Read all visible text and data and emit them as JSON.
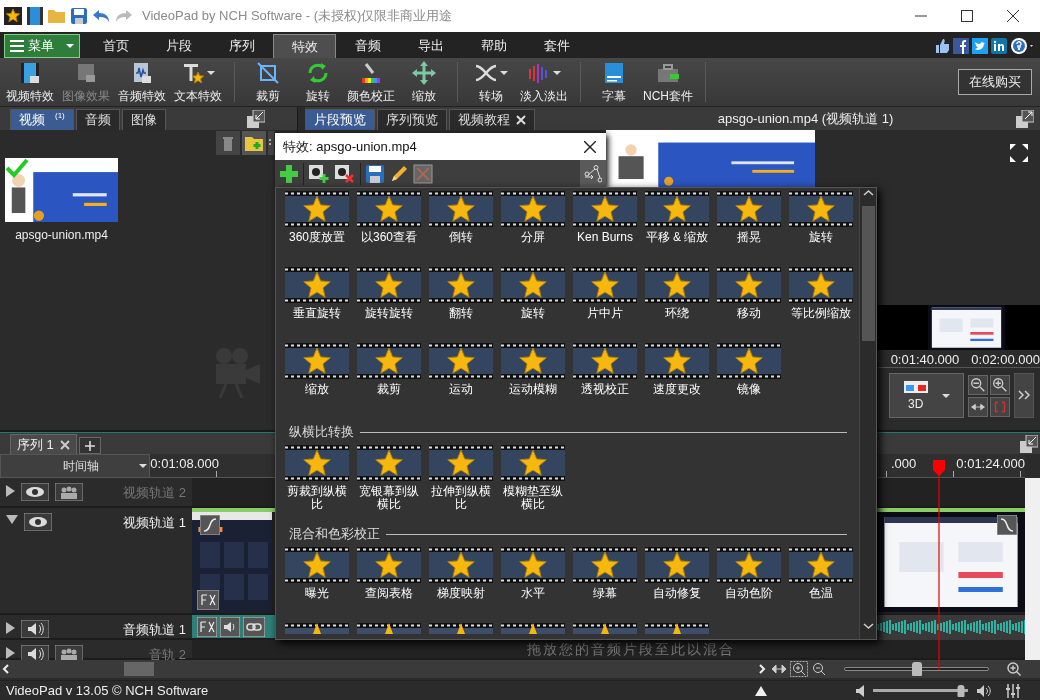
{
  "window": {
    "title": "VideoPad by NCH Software - (未授权)仅限非商业用途"
  },
  "menu_button": {
    "label": "菜单"
  },
  "tabs": [
    {
      "label": "首页",
      "selected": false
    },
    {
      "label": "片段",
      "selected": false
    },
    {
      "label": "序列",
      "selected": false
    },
    {
      "label": "特效",
      "selected": true
    },
    {
      "label": "音频",
      "selected": false
    },
    {
      "label": "导出",
      "selected": false
    },
    {
      "label": "帮助",
      "selected": false
    },
    {
      "label": "套件",
      "selected": false
    }
  ],
  "ribbon_groups": [
    [
      {
        "label": "视频特效",
        "disabled": false,
        "dropdown": false
      },
      {
        "label": "图像效果",
        "disabled": true,
        "dropdown": false
      },
      {
        "label": "音频特效",
        "disabled": false,
        "dropdown": false
      },
      {
        "label": "文本特效",
        "disabled": false,
        "dropdown": true
      }
    ],
    [
      {
        "label": "裁剪",
        "disabled": false,
        "dropdown": false
      },
      {
        "label": "旋转",
        "disabled": false,
        "dropdown": false
      },
      {
        "label": "颜色校正",
        "disabled": false,
        "dropdown": false
      },
      {
        "label": "缩放",
        "disabled": false,
        "dropdown": false
      }
    ],
    [
      {
        "label": "转场",
        "disabled": false,
        "dropdown": true
      },
      {
        "label": "淡入淡出",
        "disabled": false,
        "dropdown": true
      }
    ],
    [
      {
        "label": "字幕",
        "disabled": false,
        "dropdown": false
      },
      {
        "label": "NCH套件",
        "disabled": false,
        "dropdown": false
      }
    ]
  ],
  "buy_button": {
    "label": "在线购买"
  },
  "bin": {
    "tabs": [
      {
        "label": "视频",
        "count": "(1)",
        "selected": true
      },
      {
        "label": "音频",
        "selected": false
      },
      {
        "label": "图像",
        "selected": false
      }
    ],
    "files": [
      {
        "name": "apsgo-union.mp4",
        "checked": true
      }
    ]
  },
  "preview": {
    "tabs": [
      {
        "label": "片段预览",
        "selected": true,
        "closable": false
      },
      {
        "label": "序列预览",
        "selected": false,
        "closable": false
      },
      {
        "label": "视频教程",
        "selected": false,
        "closable": true
      }
    ],
    "title": "apsgo-union.mp4  (视频轨道 1)",
    "times": [
      "0:01:40.000",
      "0:02:00.000"
    ],
    "mode_button": {
      "label": "3D"
    }
  },
  "effects_dialog": {
    "title": "特效: apsgo-union.mp4",
    "sections": [
      {
        "items": [
          {
            "label": "360度放置",
            "kind": "effect"
          },
          {
            "label": "以360查看",
            "kind": "effect"
          },
          {
            "label": "倒转",
            "kind": "effect"
          },
          {
            "label": "分屏",
            "kind": "effect"
          },
          {
            "label": "Ken Burns",
            "kind": "effect"
          },
          {
            "label": "平移 & 缩放",
            "kind": "effect"
          },
          {
            "label": "摇晃",
            "kind": "effect"
          },
          {
            "label": "旋转",
            "kind": "effect"
          },
          {
            "label": "垂直旋转",
            "kind": "effect"
          },
          {
            "label": "旋转旋转",
            "kind": "effect"
          },
          {
            "label": "翻转",
            "kind": "effect"
          },
          {
            "label": "旋转",
            "kind": "effect"
          },
          {
            "label": "片中片",
            "kind": "effect"
          },
          {
            "label": "环绕",
            "kind": "effect"
          },
          {
            "label": "移动",
            "kind": "effect"
          },
          {
            "label": "等比例缩放",
            "kind": "effect"
          },
          {
            "label": "缩放",
            "kind": "effect"
          },
          {
            "label": "裁剪",
            "kind": "effect"
          },
          {
            "label": "运动",
            "kind": "effect"
          },
          {
            "label": "运动模糊",
            "kind": "effect"
          },
          {
            "label": "透视校正",
            "kind": "effect"
          },
          {
            "label": "速度更改",
            "kind": "effect"
          },
          {
            "label": "镜像",
            "kind": "effect"
          }
        ]
      },
      {
        "heading": "纵横比转换",
        "items": [
          {
            "label": "剪裁到纵横比",
            "kind": "effect"
          },
          {
            "label": "宽银幕到纵横比",
            "kind": "effect"
          },
          {
            "label": "拉伸到纵横比",
            "kind": "effect"
          },
          {
            "label": "模糊垫至纵横比",
            "kind": "effect"
          }
        ]
      },
      {
        "heading": "混合和色彩校正",
        "items": [
          {
            "label": "曝光",
            "kind": "effect"
          },
          {
            "label": "查阅表格",
            "kind": "effect"
          },
          {
            "label": "梯度映射",
            "kind": "effect"
          },
          {
            "label": "水平",
            "kind": "effect"
          },
          {
            "label": "绿幕",
            "kind": "effect"
          },
          {
            "label": "自动修复",
            "kind": "effect"
          },
          {
            "label": "自动色阶",
            "kind": "effect"
          },
          {
            "label": "色温",
            "kind": "effect"
          },
          {
            "kind": "partial"
          },
          {
            "kind": "partial"
          },
          {
            "kind": "partial"
          },
          {
            "kind": "partial"
          },
          {
            "kind": "partial"
          },
          {
            "kind": "partial"
          }
        ]
      }
    ]
  },
  "timeline": {
    "tabs": [
      {
        "label": "序列 1",
        "selected": true
      }
    ],
    "header": "时间轴",
    "ruler": [
      "0:01:08.000",
      ".000",
      "0:01:24.000"
    ],
    "tracks": [
      {
        "name": "视频轨道 2",
        "kind": "video",
        "expanded": false,
        "disabled": true
      },
      {
        "name": "视频轨道 1",
        "kind": "video",
        "expanded": true,
        "disabled": false
      },
      {
        "name": "音频轨道 1",
        "kind": "audio",
        "expanded": false,
        "disabled": false
      },
      {
        "name": "音轨 2",
        "kind": "audio",
        "expanded": false,
        "disabled": true
      }
    ],
    "drop_hint": "拖放您的音频片段至此以混合",
    "zoom": {
      "level": 0.5
    }
  },
  "status_bar": {
    "text": "VideoPad v 13.05 © NCH Software",
    "volume": {
      "level": 0.93
    }
  }
}
